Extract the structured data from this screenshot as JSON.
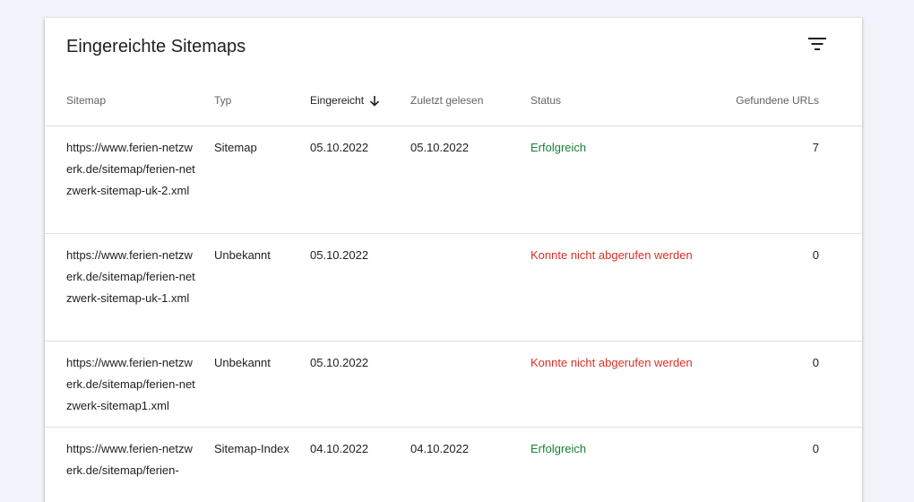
{
  "card": {
    "title": "Eingereichte Sitemaps",
    "filter_icon": "filter-list-icon"
  },
  "columns": {
    "sitemap": "Sitemap",
    "type": "Typ",
    "submitted": "Eingereicht",
    "last_read": "Zuletzt gelesen",
    "status": "Status",
    "found_urls": "Gefundene URLs",
    "sort_icon": "arrow-down-icon"
  },
  "rows": [
    {
      "sitemap": "https://www.ferien-netzwerk.de/sitemap/ferien-netzwerk-sitemap-uk-2.xml",
      "type": "Sitemap",
      "submitted": "05.10.2022",
      "last_read": "05.10.2022",
      "status": "Erfolgreich",
      "status_kind": "success",
      "found_urls": "7"
    },
    {
      "sitemap": "https://www.ferien-netzwerk.de/sitemap/ferien-netzwerk-sitemap-uk-1.xml",
      "type": "Unbekannt",
      "submitted": "05.10.2022",
      "last_read": "",
      "status": "Konnte nicht abgerufen werden",
      "status_kind": "error",
      "found_urls": "0"
    },
    {
      "sitemap": "https://www.ferien-netzwerk.de/sitemap/ferien-netzwerk-sitemap1.xml",
      "type": "Unbekannt",
      "submitted": "05.10.2022",
      "last_read": "",
      "status": "Konnte nicht abgerufen werden",
      "status_kind": "error",
      "found_urls": "0"
    },
    {
      "sitemap": "https://www.ferien-netzwerk.de/sitemap/ferien-",
      "type": "Sitemap-Index",
      "submitted": "04.10.2022",
      "last_read": "04.10.2022",
      "status": "Erfolgreich",
      "status_kind": "success",
      "found_urls": "0"
    }
  ],
  "colors": {
    "success": "#188038",
    "error": "#d93025",
    "background": "#f1f3fa"
  }
}
